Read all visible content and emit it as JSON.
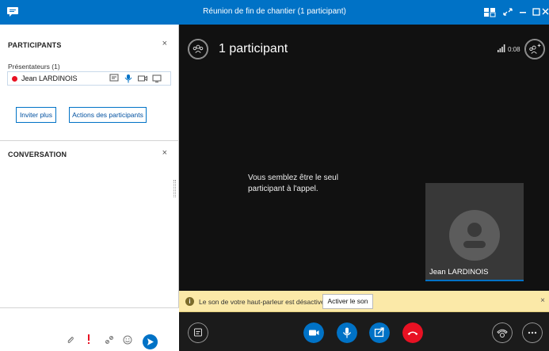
{
  "window": {
    "title": "Réunion de fin de chantier (1 participant)",
    "accent": "#0072c6"
  },
  "participants_panel": {
    "heading": "PARTICIPANTS",
    "close_glyph": "×",
    "group_label": "Présentateurs (1)",
    "participant": {
      "name": "Jean LARDINOIS",
      "status_color": "#e81123",
      "icons": [
        "im-icon",
        "microphone-icon",
        "video-icon",
        "screen-share-icon"
      ]
    },
    "invite_button": "Inviter plus",
    "actions_button": "Actions des participants"
  },
  "conversation_panel": {
    "heading": "CONVERSATION",
    "close_glyph": "×",
    "composer_icons": [
      "paperclip-icon",
      "importance-icon",
      "link-icon",
      "emoji-icon",
      "send-icon"
    ]
  },
  "stage": {
    "heading": "1 participant",
    "timer": "0:08",
    "alone_message": "Vous semblez être le seul participant à l'appel.",
    "self_name": "Jean LARDINOIS"
  },
  "notification": {
    "text": "Le son de votre haut-parleur est désactivé.",
    "action": "Activer le son",
    "close_glyph": "×"
  },
  "toolbar": {
    "buttons": [
      "im-icon",
      "video-icon",
      "microphone-icon",
      "share-icon",
      "hang-up-icon",
      "devices-icon",
      "more-icon"
    ],
    "more_glyph": "···",
    "colors": {
      "primary": "#0072c6",
      "hangup": "#e81123"
    }
  }
}
